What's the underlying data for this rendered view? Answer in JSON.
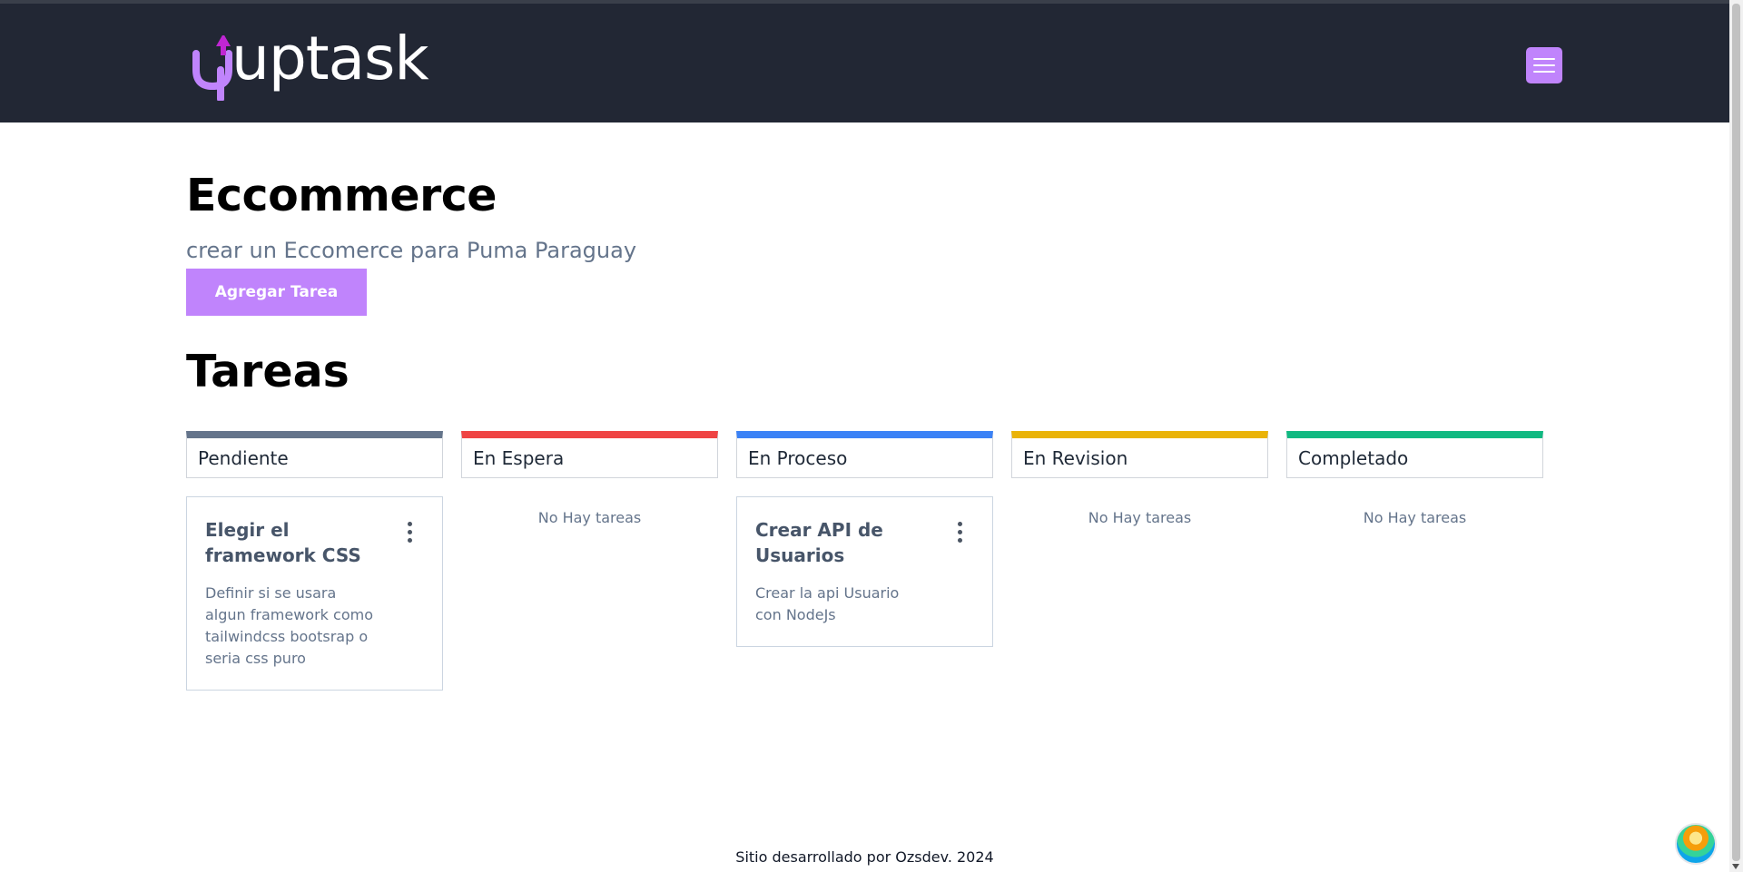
{
  "header": {
    "logo_text": "uptask",
    "menu_icon": "hamburger-icon",
    "brand_color": "#c084fc",
    "bg_color": "#222734"
  },
  "project": {
    "name": "Eccommerce",
    "description": "crear un Eccomerce para Puma Paraguay",
    "add_task_label": "Agregar Tarea"
  },
  "tasks_section": {
    "title": "Tareas",
    "empty_label": "No Hay tareas"
  },
  "columns": [
    {
      "label": "Pendiente",
      "color": "#64748b"
    },
    {
      "label": "En Espera",
      "color": "#ef4444"
    },
    {
      "label": "En Proceso",
      "color": "#3b82f6"
    },
    {
      "label": "En Revision",
      "color": "#eab308"
    },
    {
      "label": "Completado",
      "color": "#10b981"
    }
  ],
  "tasks": [
    {
      "column": "Pendiente",
      "title": "Elegir el framework CSS",
      "description": "Definir si se usara algun framework como tailwindcss bootsrap o seria css puro"
    },
    {
      "column": "En Proceso",
      "title": "Crear API de Usuarios",
      "description": "Crear la api Usuario con NodeJs"
    }
  ],
  "footer": {
    "text": "Sitio desarrollado por Ozsdev. 2024"
  }
}
